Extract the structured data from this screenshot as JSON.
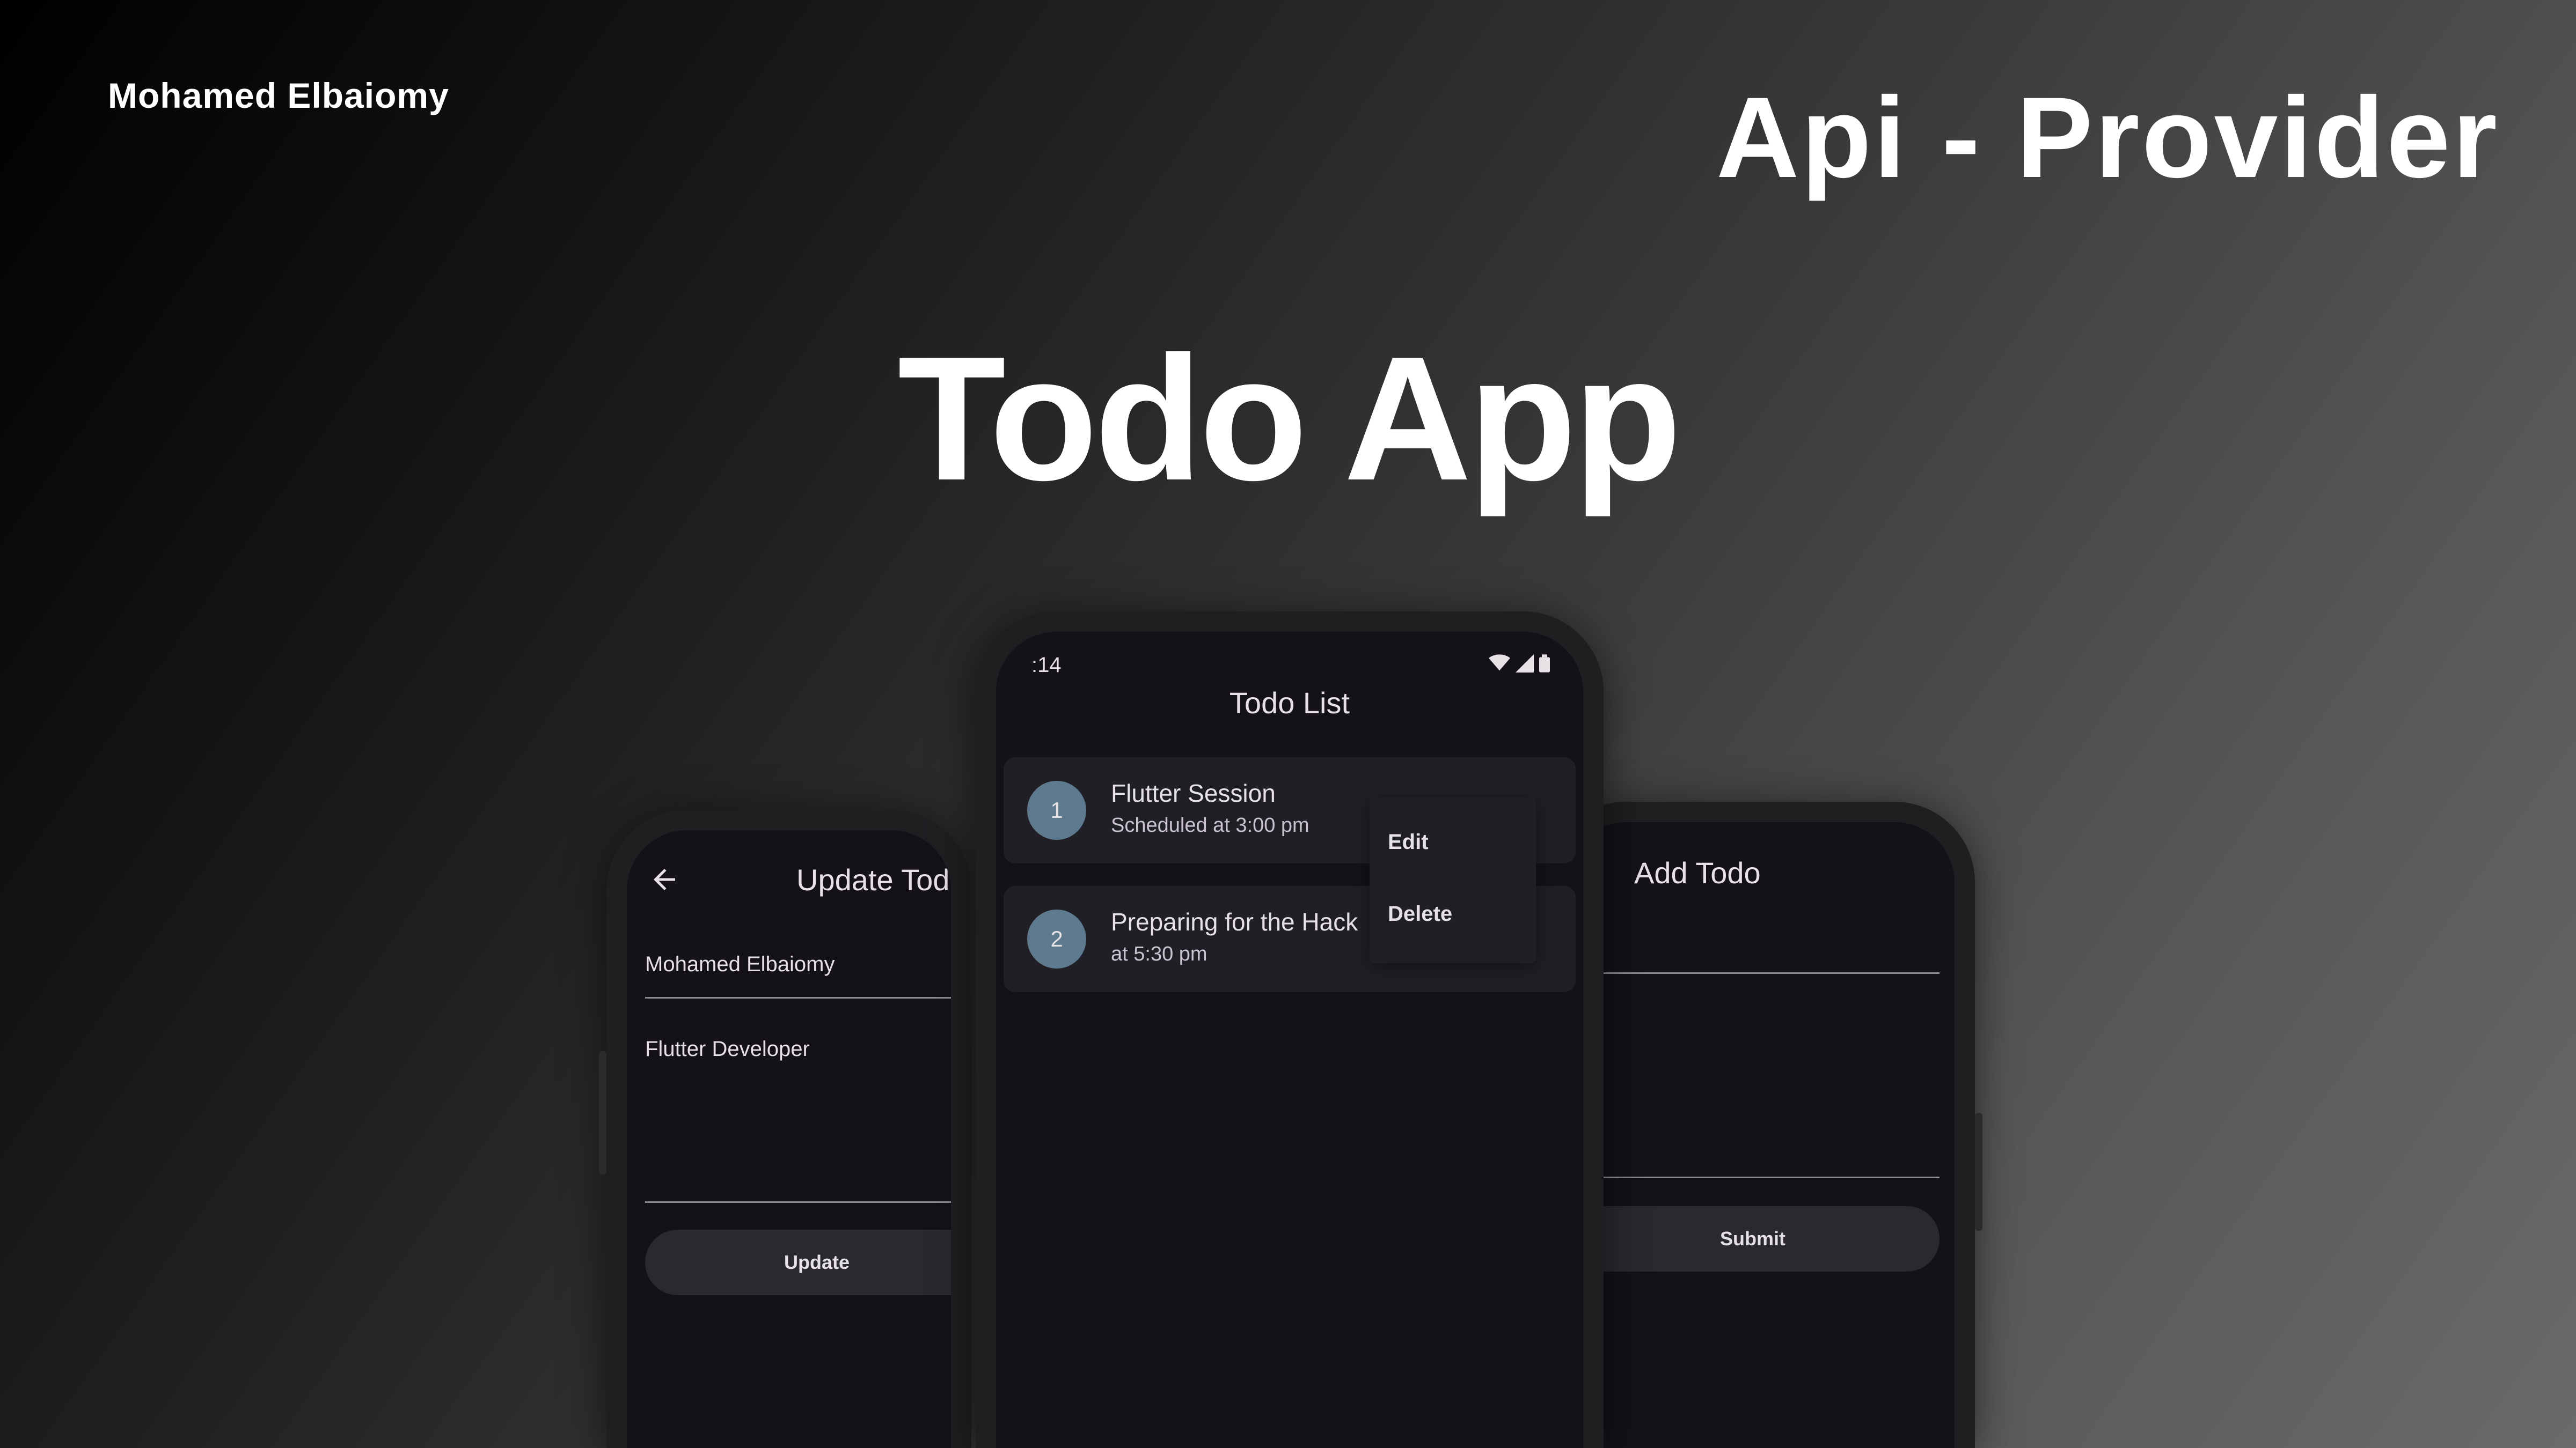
{
  "header": {
    "author": "Mohamed Elbaiomy",
    "subtitle": "Api - Provider",
    "title": "Todo App"
  },
  "update_screen": {
    "title": "Update Todo",
    "name_value": "Mohamed Elbaiomy",
    "description_value": "Flutter Developer",
    "button_label": "Update"
  },
  "add_screen": {
    "title": "Add Todo",
    "button_label": "Submit"
  },
  "list_screen": {
    "status_time": ":14",
    "title": "Todo List",
    "items": [
      {
        "number": "1",
        "title": "Flutter Session",
        "subtitle": "Scheduled at 3:00 pm"
      },
      {
        "number": "2",
        "title": "Preparing for the Hack",
        "subtitle": "at 5:30 pm"
      }
    ],
    "menu": {
      "edit_label": "Edit",
      "delete_label": "Delete"
    }
  },
  "colors": {
    "screen_background": "#141218",
    "card_background": "#211f26",
    "avatar": "#5e7a8e",
    "button_background": "#2b2930"
  },
  "icons": [
    "back-arrow-icon",
    "wifi-icon",
    "signal-icon",
    "battery-icon",
    "more-dot-icon"
  ]
}
